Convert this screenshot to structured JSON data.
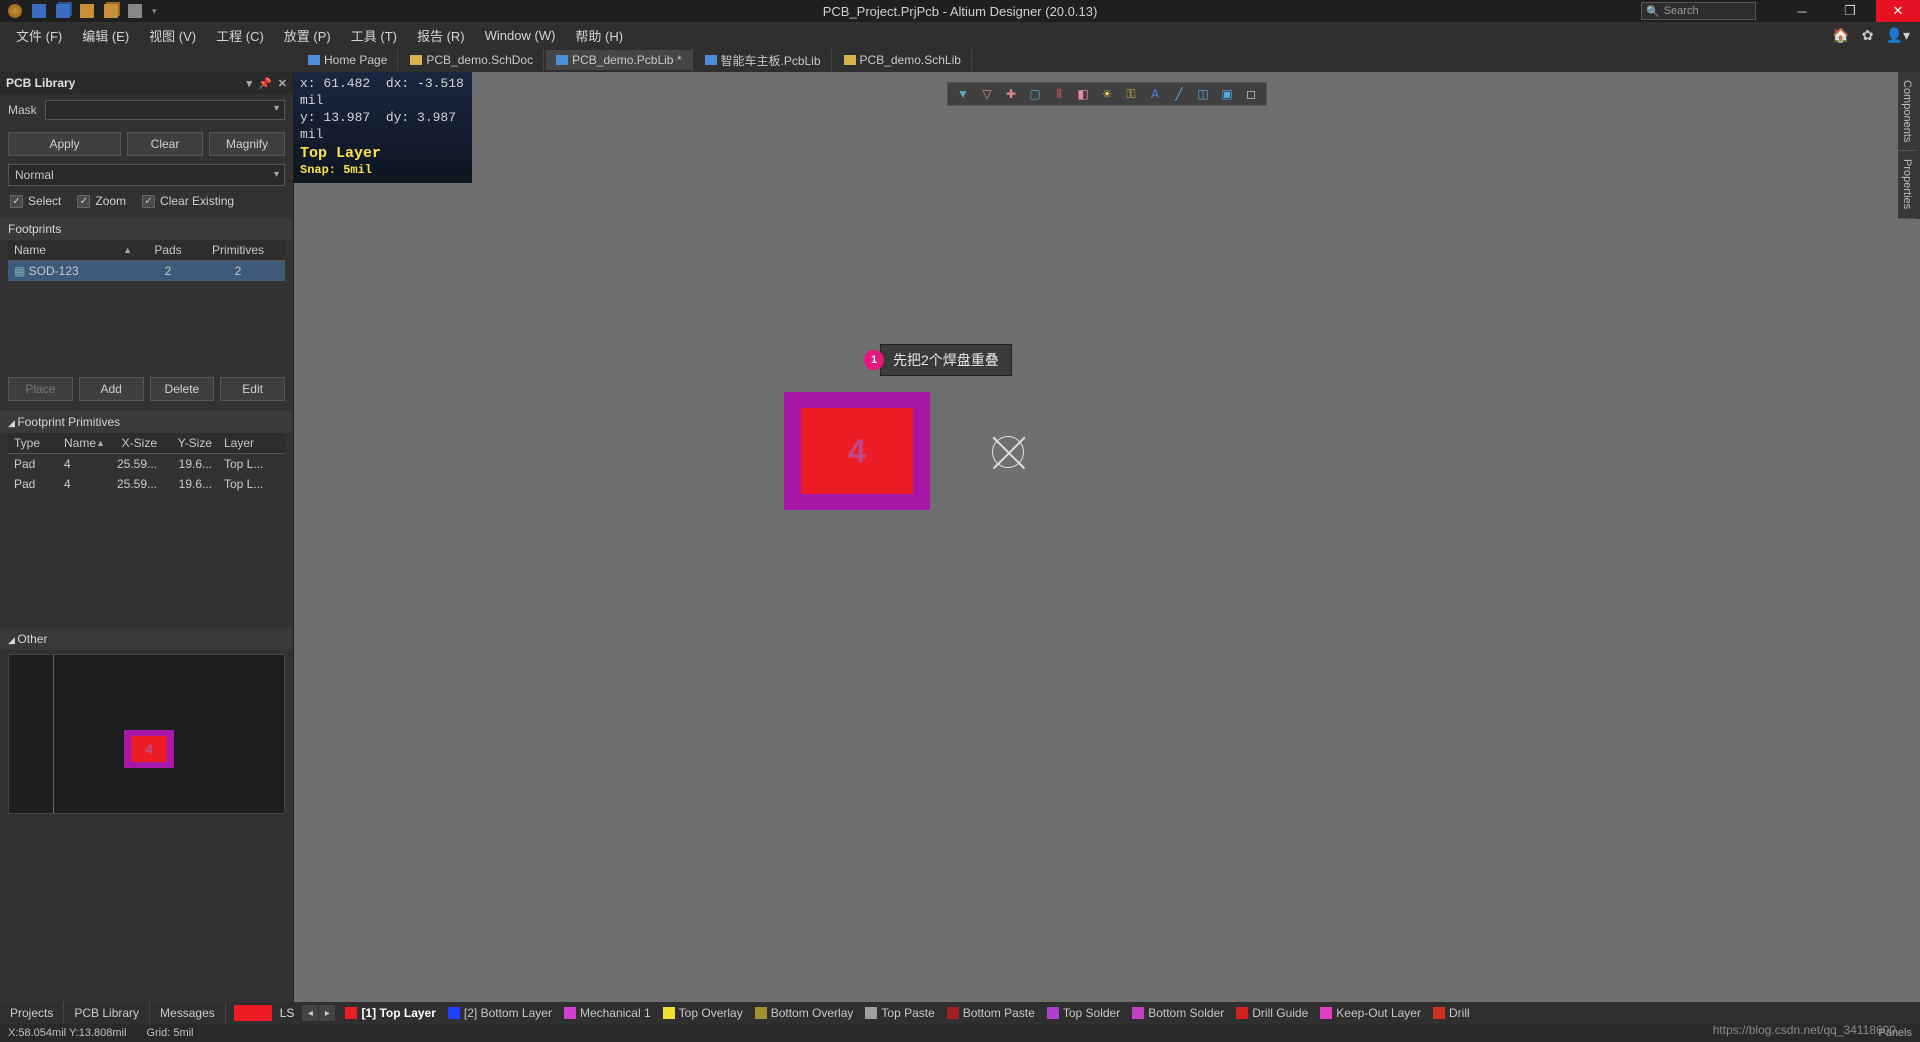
{
  "title": "PCB_Project.PrjPcb - Altium Designer (20.0.13)",
  "search_placeholder": "Search",
  "menu": [
    "文件 (F)",
    "编辑 (E)",
    "视图 (V)",
    "工程 (C)",
    "放置 (P)",
    "工具 (T)",
    "报告 (R)",
    "Window (W)",
    "帮助 (H)"
  ],
  "tabs": [
    {
      "label": "Home Page",
      "icon": "home"
    },
    {
      "label": "PCB_demo.SchDoc",
      "icon": "sch"
    },
    {
      "label": "PCB_demo.PcbLib *",
      "icon": "pcb",
      "active": true
    },
    {
      "label": "智能车主板.PcbLib",
      "icon": "pcb"
    },
    {
      "label": "PCB_demo.SchLib",
      "icon": "sch"
    }
  ],
  "panel": {
    "title": "PCB Library",
    "mask_label": "Mask",
    "apply": "Apply",
    "clear": "Clear",
    "magnify": "Magnify",
    "normal": "Normal",
    "select": "Select",
    "zoom": "Zoom",
    "clear_existing": "Clear Existing",
    "footprints": "Footprints",
    "headers": {
      "name": "Name",
      "pads": "Pads",
      "primitives": "Primitives"
    },
    "footprint_rows": [
      {
        "name": "SOD-123",
        "pads": "2",
        "primitives": "2"
      }
    ],
    "place": "Place",
    "add": "Add",
    "delete": "Delete",
    "edit": "Edit",
    "fp_primitives": "Footprint Primitives",
    "prim_headers": {
      "type": "Type",
      "name": "Name",
      "xsize": "X-Size",
      "ysize": "Y-Size",
      "layer": "Layer"
    },
    "prim_rows": [
      {
        "type": "Pad",
        "name": "4",
        "xsize": "25.59...",
        "ysize": "19.6...",
        "layer": "Top L..."
      },
      {
        "type": "Pad",
        "name": "4",
        "xsize": "25.59...",
        "ysize": "19.6...",
        "layer": "Top L..."
      }
    ],
    "other": "Other"
  },
  "hud": {
    "x": "x:    61.482",
    "dx": "dx:    -3.518  mil",
    "y": "y:    13.987",
    "dy": "dy:     3.987  mil",
    "layer": "Top Layer",
    "snap": "Snap: 5mil"
  },
  "annotation": {
    "num": "1",
    "text": "先把2个焊盘重叠"
  },
  "pad_label": "4",
  "right_tabs": [
    "Components",
    "Properties"
  ],
  "bottom_panel_tabs": [
    "Projects",
    "PCB Library",
    "Messages"
  ],
  "layer_ls": "LS",
  "layers": [
    {
      "color": "#ed1c24",
      "label": "[1] Top Layer",
      "active": true
    },
    {
      "color": "#2040ff",
      "label": "[2] Bottom Layer"
    },
    {
      "color": "#d040d0",
      "label": "Mechanical 1"
    },
    {
      "color": "#f0e030",
      "label": "Top Overlay"
    },
    {
      "color": "#a09030",
      "label": "Bottom Overlay"
    },
    {
      "color": "#a0a0a0",
      "label": "Top Paste"
    },
    {
      "color": "#a02020",
      "label": "Bottom Paste"
    },
    {
      "color": "#b040d0",
      "label": "Top Solder"
    },
    {
      "color": "#c040c0",
      "label": "Bottom Solder"
    },
    {
      "color": "#d02020",
      "label": "Drill Guide"
    },
    {
      "color": "#e040c0",
      "label": "Keep-Out Layer"
    },
    {
      "color": "#d03020",
      "label": "Drill"
    }
  ],
  "status": {
    "coords": "X:58.054mil Y:13.808mil",
    "grid": "Grid: 5mil",
    "panels": "Panels"
  },
  "watermark": "https://blog.csdn.net/qq_34118600"
}
